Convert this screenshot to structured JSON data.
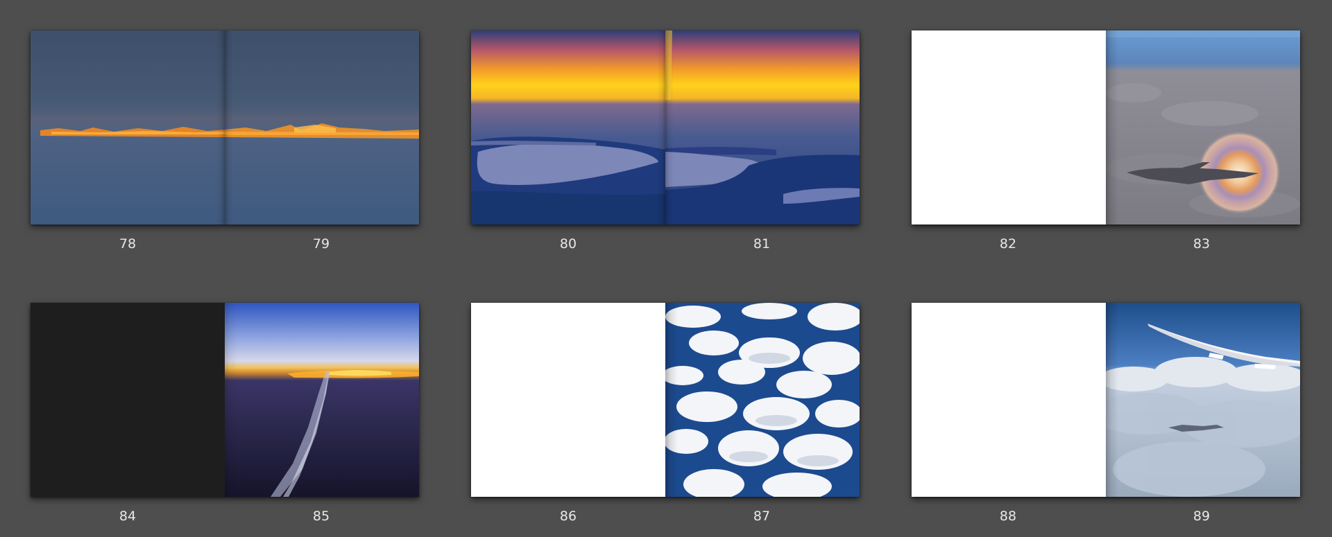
{
  "background_color": "#4e4e4e",
  "page_number_color": "#e8e8e8",
  "spreads": [
    {
      "left_page": "78",
      "right_page": "79",
      "left_content": "horizon sunset photo",
      "right_content": "horizon sunset photo"
    },
    {
      "left_page": "80",
      "right_page": "81",
      "left_content": "aerial sunset coastline photo",
      "right_content": "aerial sunset coastline photo"
    },
    {
      "left_page": "82",
      "right_page": "83",
      "left_content": "blank white page",
      "right_content": "airplane shadow on clouds with glory halo photo"
    },
    {
      "left_page": "84",
      "right_page": "85",
      "left_content": "blank dark page",
      "right_content": "contrail at dusk photo"
    },
    {
      "left_page": "86",
      "right_page": "87",
      "left_content": "blank white page",
      "right_content": "cumulus clouds over ocean photo"
    },
    {
      "left_page": "88",
      "right_page": "89",
      "left_content": "blank white page",
      "right_content": "airplane wing over clouds photo"
    }
  ]
}
